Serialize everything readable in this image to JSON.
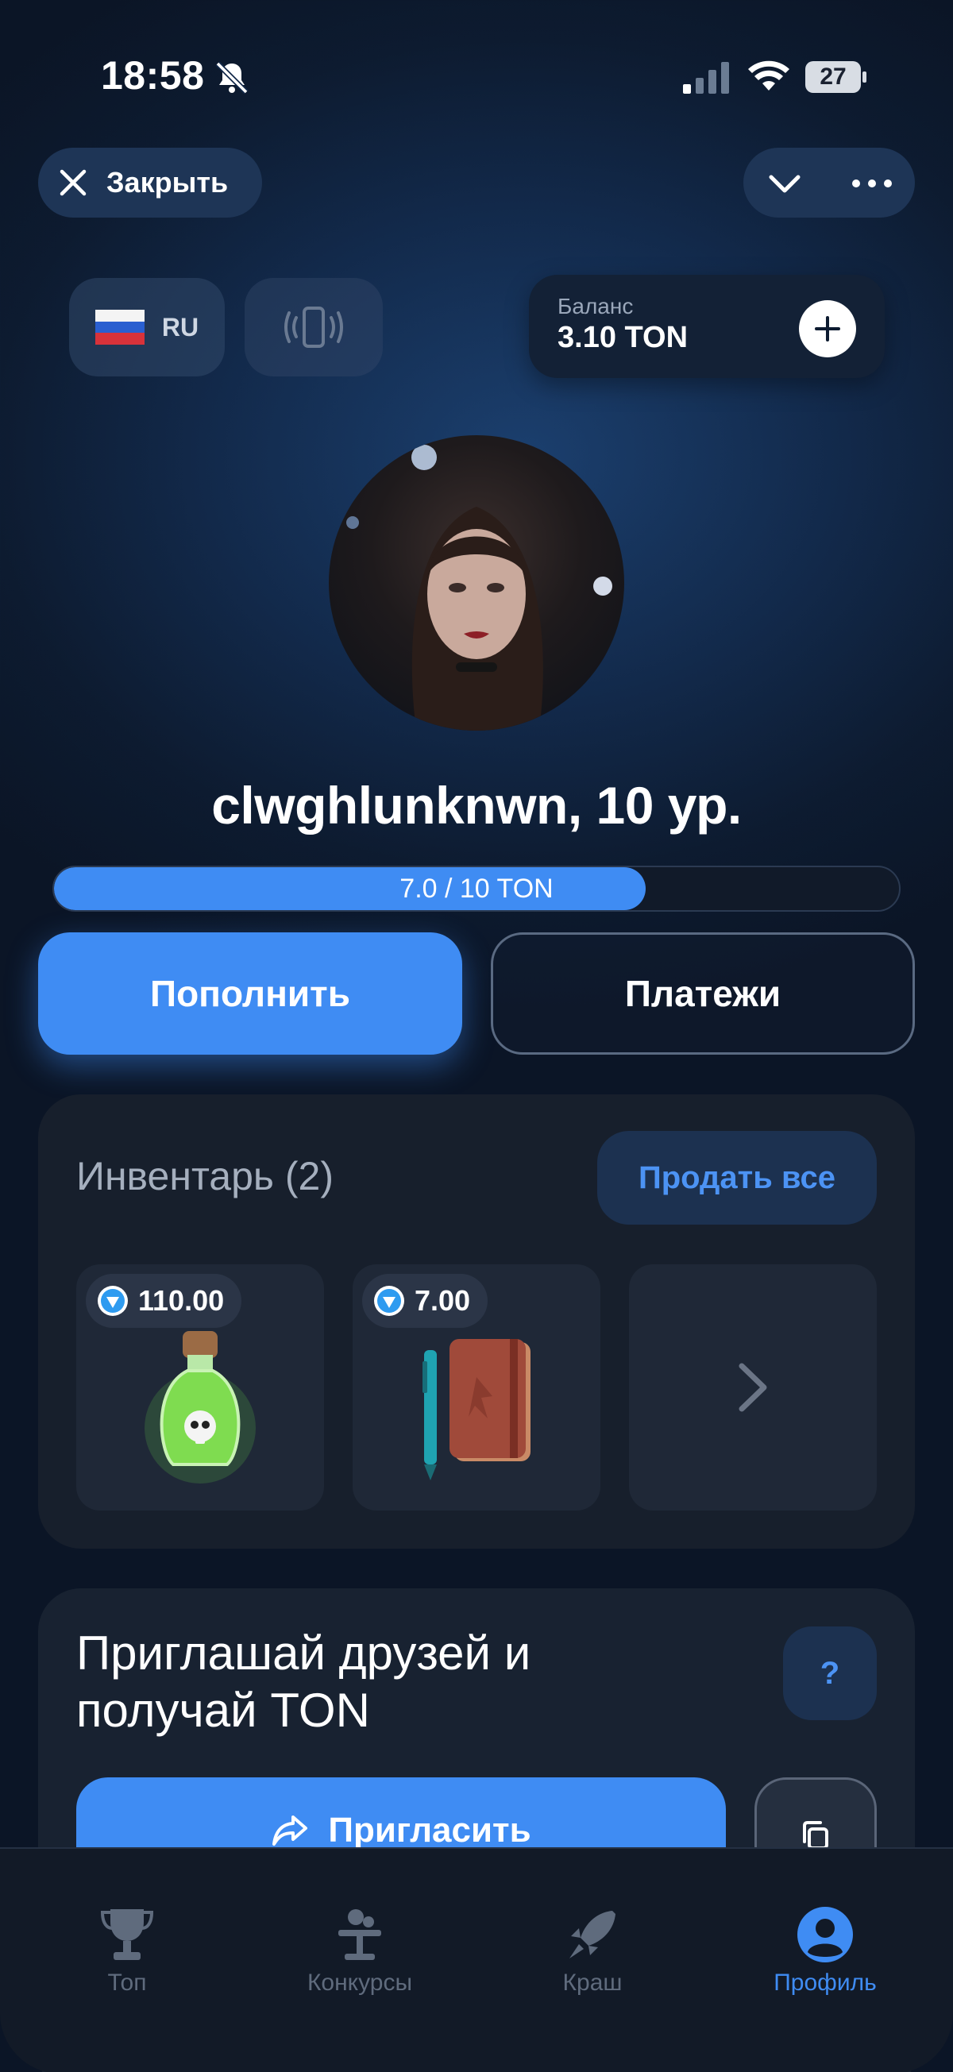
{
  "status_bar": {
    "time": "18:58",
    "battery": "27"
  },
  "header": {
    "close_label": "Закрыть"
  },
  "language": {
    "code": "RU",
    "flag": "russia-flag-icon"
  },
  "balance": {
    "label": "Баланс",
    "value": "3.10 TON"
  },
  "profile": {
    "username": "clwghlunknwn, 10 ур.",
    "progress": {
      "label": "7.0 / 10 TON",
      "current": 7.0,
      "target": 10
    }
  },
  "actions": {
    "topup": "Пополнить",
    "payments": "Платежи"
  },
  "inventory": {
    "title": "Инвентарь (2)",
    "sell_all": "Продать все",
    "items": [
      {
        "price": "110.00",
        "icon": "poison-bottle-icon"
      },
      {
        "price": "7.00",
        "icon": "notebook-pen-icon"
      }
    ]
  },
  "invite": {
    "title": "Приглашай друзей и получай TON",
    "help": "?",
    "button": "Пригласить"
  },
  "nav": [
    {
      "label": "Топ",
      "icon": "trophy-icon",
      "active": false
    },
    {
      "label": "Конкурсы",
      "icon": "raffle-table-icon",
      "active": false
    },
    {
      "label": "Краш",
      "icon": "rocket-icon",
      "active": false
    },
    {
      "label": "Профиль",
      "icon": "profile-icon",
      "active": true
    }
  ],
  "colors": {
    "accent": "#3f8cf3",
    "background": "#12294a",
    "card": "#171f2c"
  }
}
